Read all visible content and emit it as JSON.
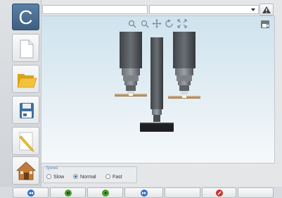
{
  "app": {
    "logo_letter": "C"
  },
  "topbar": {
    "text_field_value": "",
    "dropdown_value": "",
    "warning_icon": "warning-triangle-icon"
  },
  "sidebar": {
    "buttons": [
      {
        "name": "new-document",
        "icon": "new-file-icon"
      },
      {
        "name": "open-folder",
        "icon": "folder-icon"
      },
      {
        "name": "save",
        "icon": "floppy-disk-icon"
      },
      {
        "name": "edit",
        "icon": "pencil-icon"
      },
      {
        "name": "home",
        "icon": "house-icon"
      }
    ]
  },
  "viewport": {
    "toolbar_icons": [
      "zoom-area-icon",
      "zoom-icon",
      "pan-icon",
      "rotate-icon",
      "fit-screen-icon"
    ],
    "corner_icon": "camera-view-icon"
  },
  "speed": {
    "legend": "Speed",
    "options": [
      "Slow",
      "Normal",
      "Fast"
    ],
    "selected": "Normal"
  },
  "bottom_bar": {
    "buttons": [
      {
        "name": "rewind",
        "icon": "rewind-icon",
        "color": "#2f6fd1"
      },
      {
        "name": "pause",
        "icon": "pause-icon",
        "color": "#4aa02c"
      },
      {
        "name": "play",
        "icon": "play-icon",
        "color": "#4aa02c"
      },
      {
        "name": "fast-forward",
        "icon": "fast-forward-icon",
        "color": "#2f6fd1"
      },
      {
        "name": "empty",
        "icon": "",
        "color": ""
      },
      {
        "name": "stop",
        "icon": "no-entry-icon",
        "color": "#d2302c"
      },
      {
        "name": "empty",
        "icon": "",
        "color": ""
      }
    ]
  },
  "colors": {
    "accent_blue": "#2f6fd1",
    "accent_green": "#4aa02c",
    "accent_red": "#d2302c",
    "logo_bg": "#4b6f93"
  }
}
